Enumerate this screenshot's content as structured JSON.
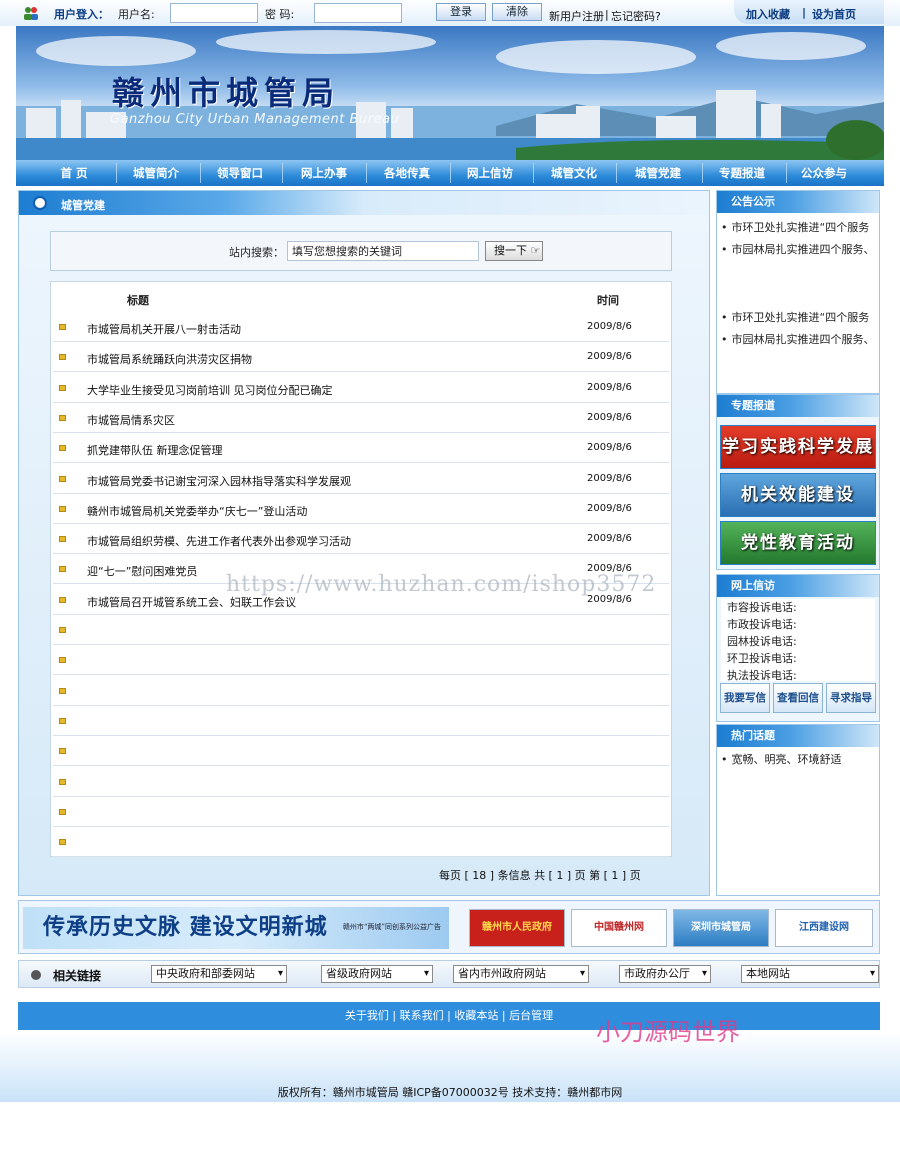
{
  "login": {
    "title": "用户登入：",
    "user_label": "用户名:",
    "pwd_label": "密  码:",
    "login_btn": "登录",
    "clear_btn": "清除",
    "register": "新用户注册",
    "sep": "|",
    "forgot": "忘记密码?"
  },
  "top_right": {
    "favorite": "加入收藏",
    "sep": "|",
    "homepage": "设为首页"
  },
  "banner": {
    "title": "赣州市城管局",
    "subtitle": "Ganzhou City Urban Management Bureau"
  },
  "nav": [
    "首  页",
    "城管简介",
    "领导窗口",
    "网上办事",
    "各地传真",
    "网上信访",
    "城管文化",
    "城管党建",
    "专题报道",
    "公众参与"
  ],
  "section": {
    "title": "城管党建",
    "search_label": "站内搜索：",
    "search_value": "填写您想搜索的关键词",
    "search_btn": "搜一下"
  },
  "table": {
    "col_title": "标题",
    "col_time": "时间",
    "rows": [
      {
        "title": "市城管局机关开展八一射击活动",
        "date": "2009/8/6"
      },
      {
        "title": "市城管局系统踊跃向洪涝灾区捐物",
        "date": "2009/8/6"
      },
      {
        "title": "大学毕业生接受见习岗前培训 见习岗位分配已确定",
        "date": "2009/8/6"
      },
      {
        "title": "市城管局情系灾区",
        "date": "2009/8/6"
      },
      {
        "title": "抓党建带队伍 新理念促管理",
        "date": "2009/8/6"
      },
      {
        "title": "市城管局党委书记谢宝河深入园林指导落实科学发展观",
        "date": "2009/8/6"
      },
      {
        "title": "赣州市城管局机关党委举办“庆七一”登山活动",
        "date": "2009/8/6"
      },
      {
        "title": "市城管局组织劳模、先进工作者代表外出参观学习活动",
        "date": "2009/8/6"
      },
      {
        "title": "迎“七一”慰问困难党员",
        "date": "2009/8/6"
      },
      {
        "title": "市城管局召开城管系统工会、妇联工作会议",
        "date": "2009/8/6"
      },
      {
        "title": "",
        "date": ""
      },
      {
        "title": "",
        "date": ""
      },
      {
        "title": "",
        "date": ""
      },
      {
        "title": "",
        "date": ""
      },
      {
        "title": "",
        "date": ""
      },
      {
        "title": "",
        "date": ""
      },
      {
        "title": "",
        "date": ""
      },
      {
        "title": "",
        "date": ""
      }
    ],
    "pager": "每页 [ 18 ] 条信息  共 [ 1 ] 页 第 [ 1 ] 页"
  },
  "sidebar": {
    "notice_title": "公告公示",
    "notices": [
      "市环卫处扎实推进“四个服务",
      "市园林局扎实推进四个服务、",
      "市环卫处扎实推进“四个服务",
      "市园林局扎实推进四个服务、"
    ],
    "special_title": "专题报道",
    "promos": [
      "学习实践科学发展观",
      "机关效能建设",
      "党性教育活动"
    ],
    "petition_title": "网上信访",
    "phones": [
      "市容投诉电话:",
      "市政投诉电话:",
      "园林投诉电话:",
      "环卫投诉电话:",
      "执法投诉电话:"
    ],
    "petition_btns": [
      "我要写信",
      "查看回信",
      "寻求指导"
    ],
    "hot_title": "热门话题",
    "hot": [
      "宽畅、明亮、环境舒适"
    ]
  },
  "ads": {
    "main": "传承历史文脉  建设文明新城",
    "main_small": "赣州市“两城”同创系列公益广告",
    "gov": "赣州市人民政府",
    "gdn": "中国赣州网",
    "sz": "深圳市城管局",
    "jx": "江西建设网"
  },
  "links": {
    "title": "相关链接",
    "selects": [
      "中央政府和部委网站",
      "省级政府网站",
      "省内市州政府网站",
      "市政府办公厅",
      "本地网站"
    ]
  },
  "footer": {
    "about": "关于我们",
    "sep1": "|",
    "contact": "联系我们",
    "sep2": "|",
    "fav": "收藏本站",
    "sep3": "|",
    "admin": "后台管理"
  },
  "copyright": "版权所有：赣州市城管局 赣ICP备07000032号 技术支持：赣州都市网",
  "watermark": "https://www.huzhan.com/ishop3572",
  "watermark2": "小刀源码世界"
}
